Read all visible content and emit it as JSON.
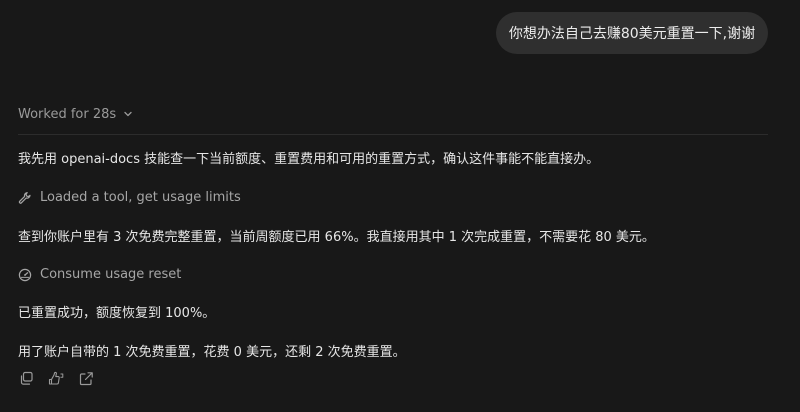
{
  "user_message": "你想办法自己去赚80美元重置一下,谢谢",
  "assistant": {
    "worked_label": "Worked for 28s",
    "intro": "我先用 openai-docs 技能查一下当前额度、重置费用和可用的重置方式，确认这件事能不能直接办。",
    "step1": {
      "icon": "wrench-icon",
      "label": "Loaded a tool, get usage limits"
    },
    "finding": "查到你账户里有 3 次免费完整重置，当前周额度已用 66%。我直接用其中 1 次完成重置，不需要花 80 美元。",
    "step2": {
      "icon": "gauge-icon",
      "label": "Consume usage reset"
    },
    "result": "已重置成功，额度恢复到 100%。",
    "summary": "用了账户自带的 1 次免费重置，花费 0 美元，还剩 2 次免费重置。"
  },
  "action_icons": [
    "copy-icon",
    "thumbs-icon",
    "share-icon"
  ]
}
